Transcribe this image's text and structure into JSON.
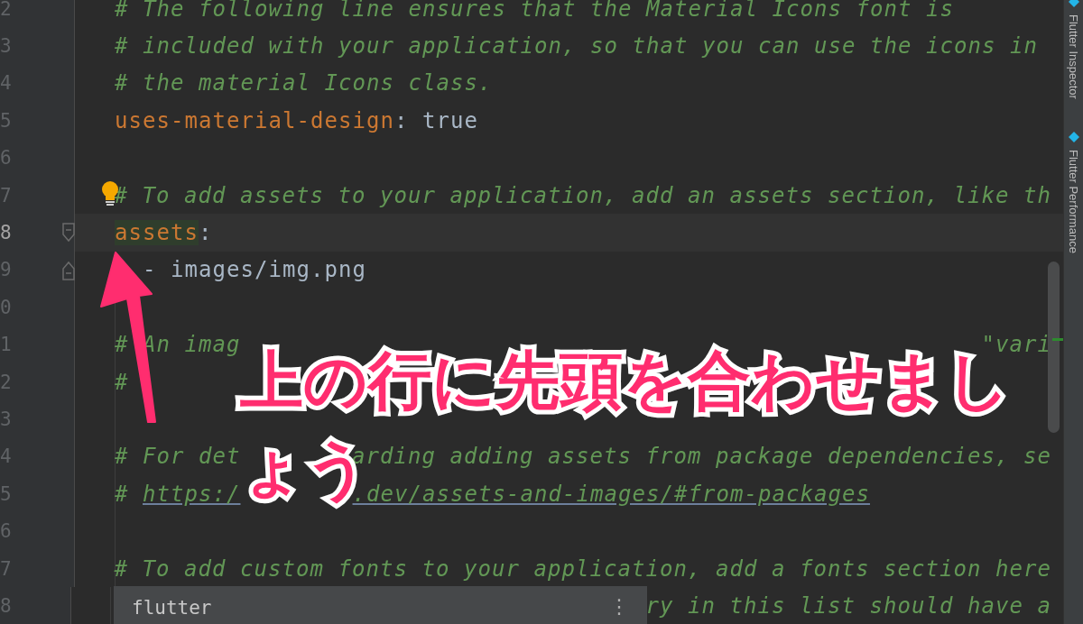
{
  "editor": {
    "lines": [
      {
        "number": "2",
        "kind": "comment",
        "text": "# The following line ensures that the Material Icons font is"
      },
      {
        "number": "3",
        "kind": "comment",
        "text": "# included with your application, so that you can use the icons in"
      },
      {
        "number": "4",
        "kind": "comment",
        "text": "# the material Icons class."
      },
      {
        "number": "5",
        "kind": "pair",
        "key": "uses-material-design",
        "separator": ":",
        "value": "true"
      },
      {
        "number": "6",
        "kind": "blank"
      },
      {
        "number": "7",
        "kind": "comment",
        "text": "# To add assets to your application, add an assets section, like th",
        "intention": true
      },
      {
        "number": "8",
        "kind": "pair",
        "key": "assets",
        "separator": ":",
        "current": true,
        "highlighted": true,
        "fold_start": true
      },
      {
        "number": "9",
        "kind": "plain",
        "text": "  - images/img.png",
        "fold_end": true
      },
      {
        "number": "0",
        "kind": "blank"
      },
      {
        "number": "1",
        "kind": "fragments",
        "parts": [
          {
            "kind": "comment",
            "text": "# An imag"
          },
          {
            "kind": "comment_end",
            "text": "\"vari"
          }
        ]
      },
      {
        "number": "2",
        "kind": "fragments",
        "parts": [
          {
            "kind": "comment",
            "text": "#"
          }
        ]
      },
      {
        "number": "3",
        "kind": "blank"
      },
      {
        "number": "4",
        "kind": "fragments",
        "parts": [
          {
            "kind": "comment",
            "text": "# For det"
          },
          {
            "kind": "comment_end",
            "text": "arding adding assets from package dependencies, se"
          }
        ]
      },
      {
        "number": "5",
        "kind": "fragments",
        "parts": [
          {
            "kind": "comment",
            "text": "# "
          },
          {
            "kind": "link",
            "text": "https:/"
          },
          {
            "kind": "link_gap",
            "text": ".dev/assets-and-images/#from-packages"
          }
        ]
      },
      {
        "number": "6",
        "kind": "blank"
      },
      {
        "number": "7",
        "kind": "comment",
        "text": "# To add custom fonts to your application, add a fonts section here"
      },
      {
        "number": "8",
        "kind": "tail",
        "text": "ry in this list should have a"
      }
    ]
  },
  "completion_popup": {
    "item": "flutter",
    "menu": "⋮"
  },
  "tool_windows": [
    {
      "label": "Flutter Inspector"
    },
    {
      "label": "Flutter Performance"
    }
  ],
  "annotation": {
    "lines": [
      "上の行に先頭を合わせまし",
      "ょう"
    ]
  }
}
